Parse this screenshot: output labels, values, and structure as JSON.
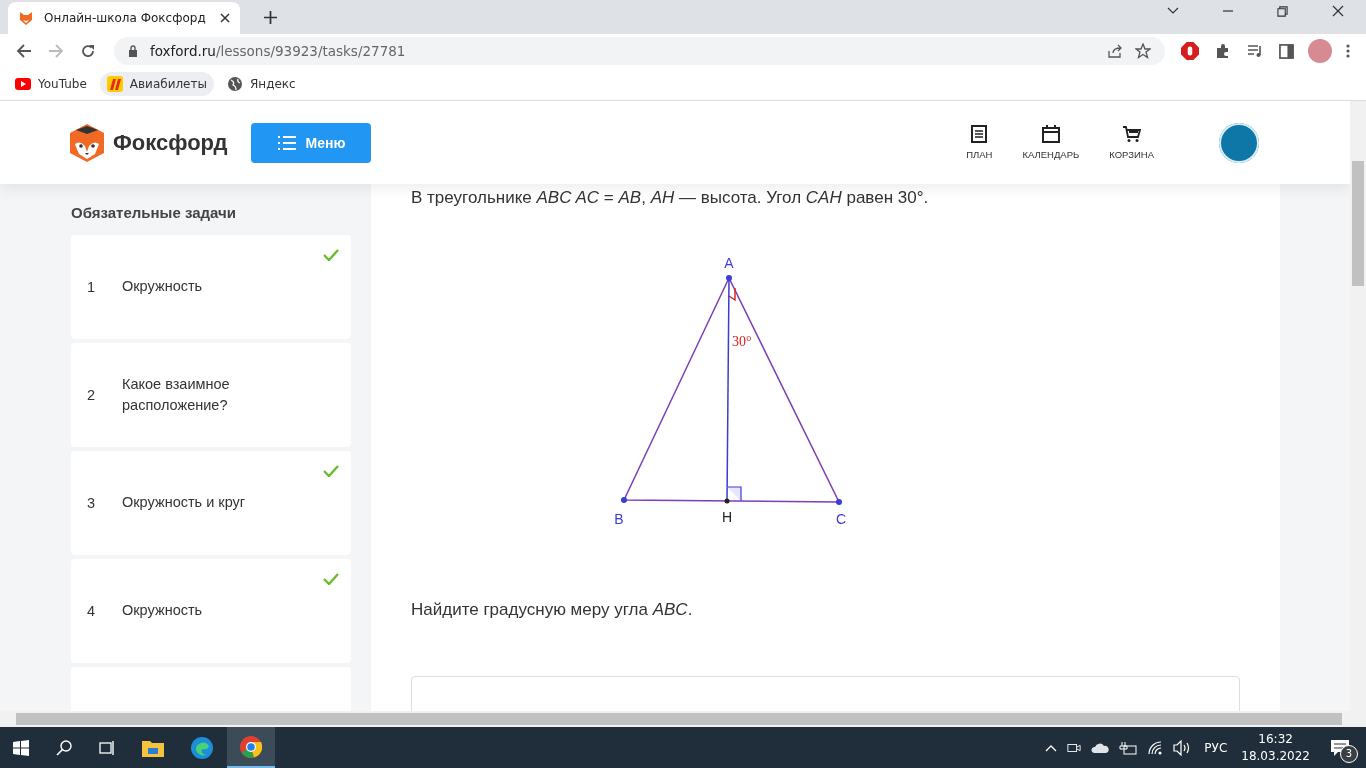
{
  "browser": {
    "tab": {
      "title": "Онлайн-школа Фоксфорд",
      "selected": true
    },
    "url_host": "foxford.ru",
    "url_path": "/lessons/93923/tasks/27781",
    "bookmarks": [
      {
        "label": "YouTube",
        "kind": "youtube",
        "selected": false
      },
      {
        "label": "Авиабилеты",
        "kind": "tickets",
        "selected": true
      },
      {
        "label": "Яндекс",
        "kind": "globe",
        "selected": false
      }
    ]
  },
  "header": {
    "logo": "Фоксфорд",
    "menu_button": "Меню",
    "nav": [
      {
        "label": "ПЛАН",
        "kind": "plan"
      },
      {
        "label": "КАЛЕНДАРЬ",
        "kind": "calendar"
      },
      {
        "label": "КОРЗИНА",
        "kind": "cart"
      }
    ]
  },
  "sidebar": {
    "title": "Обязательные задачи",
    "items": [
      {
        "number": "1",
        "title": "Окружность",
        "done": true
      },
      {
        "number": "2",
        "title": "Какое взаимное расположение?",
        "done": false
      },
      {
        "number": "3",
        "title": "Окружность и круг",
        "done": true
      },
      {
        "number": "4",
        "title": "Окружность",
        "done": true
      }
    ]
  },
  "task": {
    "statement": "В треугольнике *ABC AC* = *AB*, *AH* — высота. Угол *CAH* равен 30°.",
    "figure": {
      "labels": {
        "A": "A",
        "B": "B",
        "C": "C",
        "H": "H"
      },
      "angle": "30°"
    },
    "question": "Найдите градусную меру угла *ABC*."
  },
  "taskbar": {
    "language": "РУС",
    "time": "16:32",
    "date": "18.03.2022",
    "notifications": "3"
  }
}
